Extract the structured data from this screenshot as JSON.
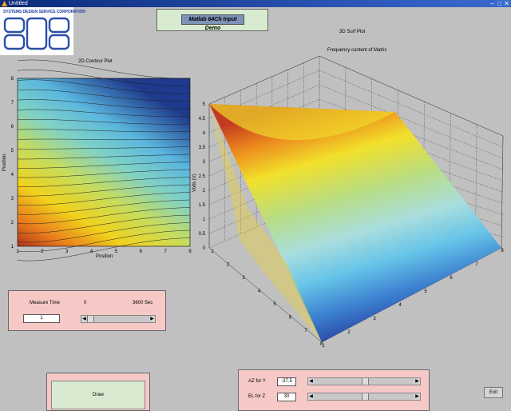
{
  "window": {
    "title": "Untitled",
    "icon": "matlab-figure-icon"
  },
  "logo": {
    "text": "SYSTEMS DESIGN SERVICE CORPORATION",
    "mark": "SDS"
  },
  "demo_label": "Matlab 64Ch Input Demo",
  "contour": {
    "title": "2D Contour Plot",
    "xlabel": "Position",
    "ylabel": "Position",
    "xticks": [
      "1",
      "2",
      "3",
      "4",
      "5",
      "6",
      "7",
      "8"
    ],
    "yticks": [
      "1",
      "2",
      "3",
      "4",
      "5",
      "6",
      "7",
      "8"
    ]
  },
  "surf": {
    "title": "3D Surf Plot",
    "subtitle": "Frequency content of Matrix",
    "zlabel": "Volts (V)",
    "zticks": [
      "0",
      "0.5",
      "1",
      "1.5",
      "2",
      "2.5",
      "3",
      "3.5",
      "4",
      "4.5",
      "5"
    ],
    "left_ticks": [
      "1",
      "2",
      "3",
      "4",
      "5",
      "6",
      "7",
      "8"
    ],
    "right_ticks": [
      "1",
      "2",
      "3",
      "4",
      "5",
      "6",
      "7",
      "8"
    ]
  },
  "measure": {
    "label": "Measure Time",
    "min_label": "0",
    "max_label": "3600 Sec",
    "value": "1",
    "slider_fraction": 0.0
  },
  "view": {
    "az_label": "AZ for Y",
    "az_value": "-37.5",
    "az_fraction": 0.5,
    "el_label": "EL for Z",
    "el_value": "30",
    "el_fraction": 0.5
  },
  "buttons": {
    "draw": "Draw",
    "exit": "Exit"
  },
  "colors": {
    "panel": "#f6c9c6",
    "green_panel": "#d8ebd1"
  }
}
